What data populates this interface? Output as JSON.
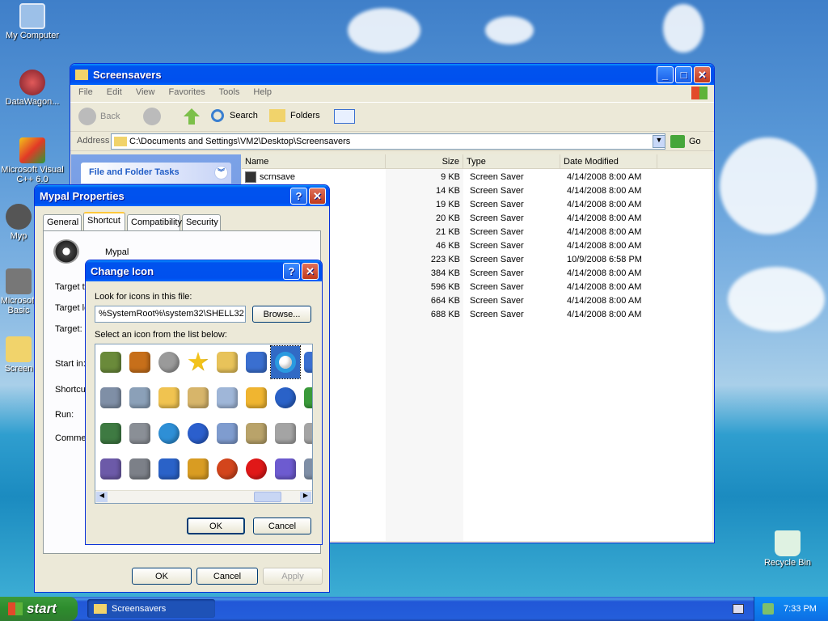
{
  "desktop": {
    "icons": [
      {
        "label": "My Computer",
        "icon": "computer-icon",
        "color": "#9cc0e8"
      },
      {
        "label": "DataWagon...",
        "icon": "datawagon-icon",
        "color": "#b0323a"
      },
      {
        "label": "Microsoft Visual C++ 6.0",
        "icon": "visual-cpp-icon",
        "color": "#e23a26"
      },
      {
        "label": "Myp",
        "icon": "mypal-icon",
        "color": "#444"
      },
      {
        "label": "Microsoft Basic",
        "icon": "vb-icon",
        "color": "#777"
      },
      {
        "label": "Screen",
        "icon": "folder-icon",
        "color": "#f1d36b"
      },
      {
        "label": "Recycle Bin",
        "icon": "recycle-bin-icon",
        "color": "#dff2e2"
      }
    ]
  },
  "explorer": {
    "title": "Screensavers",
    "menu": [
      "File",
      "Edit",
      "View",
      "Favorites",
      "Tools",
      "Help"
    ],
    "toolbar": {
      "back": "Back",
      "search": "Search",
      "folders": "Folders"
    },
    "address_label": "Address",
    "address": "C:\\Documents and Settings\\VM2\\Desktop\\Screensavers",
    "go": "Go",
    "tasks_title": "File and Folder Tasks",
    "columns": [
      "Name",
      "Size",
      "Type",
      "Date Modified"
    ],
    "files": [
      {
        "name": "scrnsave",
        "size": "9 KB",
        "type": "Screen Saver",
        "date": "4/14/2008 8:00 AM"
      },
      {
        "name": "",
        "size": "14 KB",
        "type": "Screen Saver",
        "date": "4/14/2008 8:00 AM"
      },
      {
        "name": "",
        "size": "19 KB",
        "type": "Screen Saver",
        "date": "4/14/2008 8:00 AM"
      },
      {
        "name": "",
        "size": "20 KB",
        "type": "Screen Saver",
        "date": "4/14/2008 8:00 AM"
      },
      {
        "name": "",
        "size": "21 KB",
        "type": "Screen Saver",
        "date": "4/14/2008 8:00 AM"
      },
      {
        "name": "",
        "size": "46 KB",
        "type": "Screen Saver",
        "date": "4/14/2008 8:00 AM"
      },
      {
        "name": "",
        "size": "223 KB",
        "type": "Screen Saver",
        "date": "10/9/2008 6:58 PM"
      },
      {
        "name": "",
        "size": "384 KB",
        "type": "Screen Saver",
        "date": "4/14/2008 8:00 AM"
      },
      {
        "name": "",
        "size": "596 KB",
        "type": "Screen Saver",
        "date": "4/14/2008 8:00 AM"
      },
      {
        "name": "",
        "size": "664 KB",
        "type": "Screen Saver",
        "date": "4/14/2008 8:00 AM"
      },
      {
        "name": "",
        "size": "688 KB",
        "type": "Screen Saver",
        "date": "4/14/2008 8:00 AM"
      }
    ]
  },
  "props": {
    "title": "Mypal Properties",
    "tabs": [
      "General",
      "Shortcut",
      "Compatibility",
      "Security"
    ],
    "name": "Mypal",
    "labels": [
      "Target ty",
      "Target lo",
      "Target:",
      "Start in:",
      "Shortcu",
      "Run:",
      "Commen"
    ],
    "ok": "OK",
    "cancel": "Cancel",
    "apply": "Apply"
  },
  "change_icon": {
    "title": "Change Icon",
    "look_label": "Look for icons in this file:",
    "path": "%SystemRoot%\\system32\\SHELL32",
    "browse": "Browse...",
    "select_label": "Select an icon from the list below:",
    "ok": "OK",
    "cancel": "Cancel",
    "icons": [
      {
        "name": "mobile-phone-icon",
        "color": "#6a8a3a"
      },
      {
        "name": "pda-icon",
        "color": "#c76f1a"
      },
      {
        "name": "dvd-rw-icon",
        "color": "#9a9a9a"
      },
      {
        "name": "star-icon",
        "color": "#f2c21b"
      },
      {
        "name": "calendar-folder-icon",
        "color": "#e8c35a"
      },
      {
        "name": "checklist-icon",
        "color": "#3a6fd0"
      },
      {
        "name": "internet-explorer-icon",
        "color": "#2a76d4"
      },
      {
        "name": "partial-icon",
        "color": "#3a6fd0"
      },
      {
        "name": "network-printer-icon",
        "color": "#7f8fa6"
      },
      {
        "name": "scanner-icon",
        "color": "#8ba0b8"
      },
      {
        "name": "new-folder-icon",
        "color": "#f0c350"
      },
      {
        "name": "magnifier-icon",
        "color": "#d7b56a"
      },
      {
        "name": "scheduled-task-icon",
        "color": "#9fb6d8"
      },
      {
        "name": "stack-icon",
        "color": "#f0b530"
      },
      {
        "name": "info-icon",
        "color": "#2a62c8"
      },
      {
        "name": "network-icon",
        "color": "#3a9a3a"
      },
      {
        "name": "drive-icon",
        "color": "#3e7a42"
      },
      {
        "name": "camera-icon",
        "color": "#8a8f96"
      },
      {
        "name": "clock-icon",
        "color": "#2e8fd6"
      },
      {
        "name": "help-icon",
        "color": "#2b5fcd"
      },
      {
        "name": "tape-icon",
        "color": "#7f9ccf"
      },
      {
        "name": "search-computer-icon",
        "color": "#b9a36a"
      },
      {
        "name": "printer-check-icon",
        "color": "#a4a4a4"
      },
      {
        "name": "partial-icon-2",
        "color": "#a4a4a4"
      },
      {
        "name": "zip-drive-icon",
        "color": "#6c5aa8"
      },
      {
        "name": "camcorder-icon",
        "color": "#7c8088"
      },
      {
        "name": "checkbox-icon",
        "color": "#2a62c8"
      },
      {
        "name": "key-icon",
        "color": "#d99c22"
      },
      {
        "name": "power-icon",
        "color": "#d3451c"
      },
      {
        "name": "prohibited-icon",
        "color": "#e01818"
      },
      {
        "name": "pen-window-icon",
        "color": "#6d5bd0"
      },
      {
        "name": "partial-icon-3",
        "color": "#7f8fa6"
      }
    ]
  },
  "taskbar": {
    "start": "start",
    "task": "Screensavers",
    "time": "7:33 PM"
  }
}
